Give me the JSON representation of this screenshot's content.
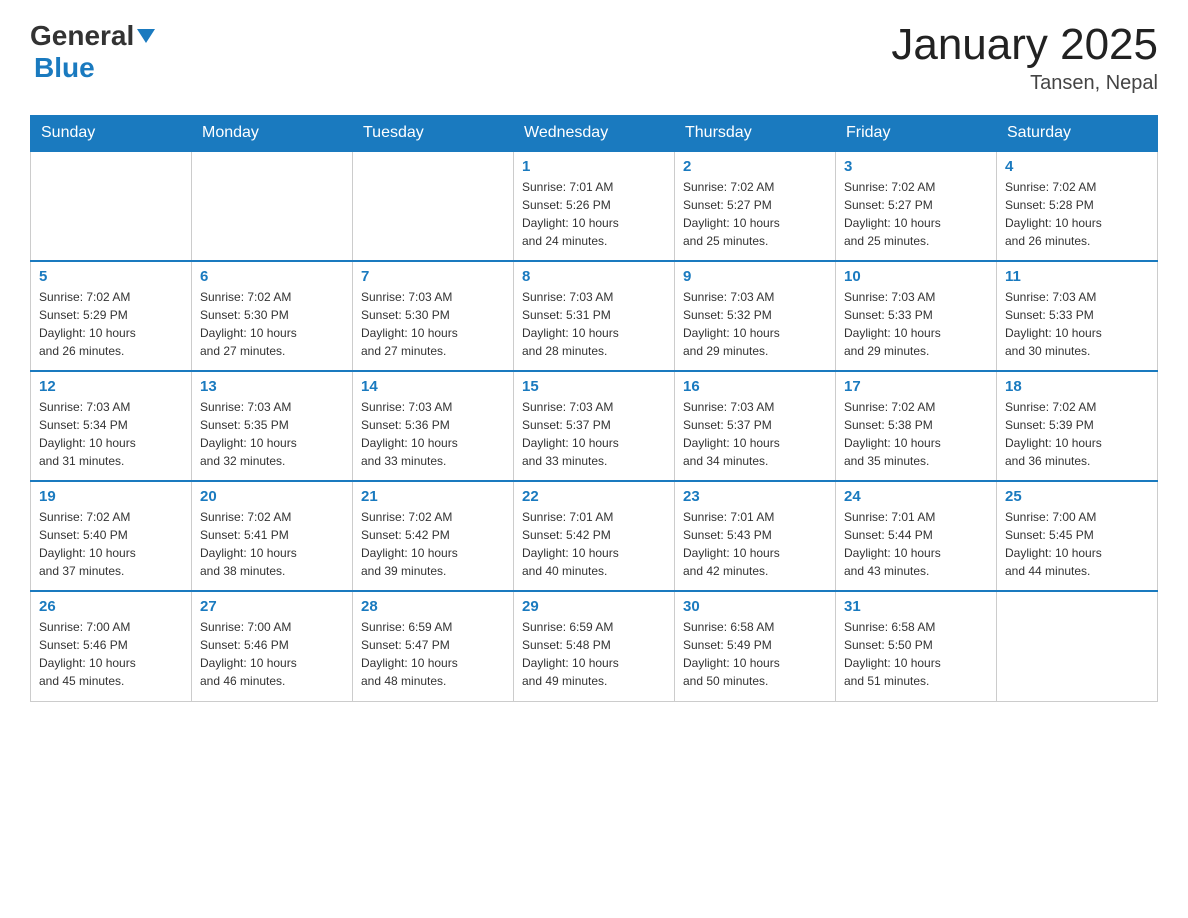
{
  "header": {
    "logo_general": "General",
    "logo_blue": "Blue",
    "month_title": "January 2025",
    "location": "Tansen, Nepal"
  },
  "calendar": {
    "days_of_week": [
      "Sunday",
      "Monday",
      "Tuesday",
      "Wednesday",
      "Thursday",
      "Friday",
      "Saturday"
    ],
    "weeks": [
      {
        "days": [
          {
            "number": "",
            "info": ""
          },
          {
            "number": "",
            "info": ""
          },
          {
            "number": "",
            "info": ""
          },
          {
            "number": "1",
            "info": "Sunrise: 7:01 AM\nSunset: 5:26 PM\nDaylight: 10 hours\nand 24 minutes."
          },
          {
            "number": "2",
            "info": "Sunrise: 7:02 AM\nSunset: 5:27 PM\nDaylight: 10 hours\nand 25 minutes."
          },
          {
            "number": "3",
            "info": "Sunrise: 7:02 AM\nSunset: 5:27 PM\nDaylight: 10 hours\nand 25 minutes."
          },
          {
            "number": "4",
            "info": "Sunrise: 7:02 AM\nSunset: 5:28 PM\nDaylight: 10 hours\nand 26 minutes."
          }
        ]
      },
      {
        "days": [
          {
            "number": "5",
            "info": "Sunrise: 7:02 AM\nSunset: 5:29 PM\nDaylight: 10 hours\nand 26 minutes."
          },
          {
            "number": "6",
            "info": "Sunrise: 7:02 AM\nSunset: 5:30 PM\nDaylight: 10 hours\nand 27 minutes."
          },
          {
            "number": "7",
            "info": "Sunrise: 7:03 AM\nSunset: 5:30 PM\nDaylight: 10 hours\nand 27 minutes."
          },
          {
            "number": "8",
            "info": "Sunrise: 7:03 AM\nSunset: 5:31 PM\nDaylight: 10 hours\nand 28 minutes."
          },
          {
            "number": "9",
            "info": "Sunrise: 7:03 AM\nSunset: 5:32 PM\nDaylight: 10 hours\nand 29 minutes."
          },
          {
            "number": "10",
            "info": "Sunrise: 7:03 AM\nSunset: 5:33 PM\nDaylight: 10 hours\nand 29 minutes."
          },
          {
            "number": "11",
            "info": "Sunrise: 7:03 AM\nSunset: 5:33 PM\nDaylight: 10 hours\nand 30 minutes."
          }
        ]
      },
      {
        "days": [
          {
            "number": "12",
            "info": "Sunrise: 7:03 AM\nSunset: 5:34 PM\nDaylight: 10 hours\nand 31 minutes."
          },
          {
            "number": "13",
            "info": "Sunrise: 7:03 AM\nSunset: 5:35 PM\nDaylight: 10 hours\nand 32 minutes."
          },
          {
            "number": "14",
            "info": "Sunrise: 7:03 AM\nSunset: 5:36 PM\nDaylight: 10 hours\nand 33 minutes."
          },
          {
            "number": "15",
            "info": "Sunrise: 7:03 AM\nSunset: 5:37 PM\nDaylight: 10 hours\nand 33 minutes."
          },
          {
            "number": "16",
            "info": "Sunrise: 7:03 AM\nSunset: 5:37 PM\nDaylight: 10 hours\nand 34 minutes."
          },
          {
            "number": "17",
            "info": "Sunrise: 7:02 AM\nSunset: 5:38 PM\nDaylight: 10 hours\nand 35 minutes."
          },
          {
            "number": "18",
            "info": "Sunrise: 7:02 AM\nSunset: 5:39 PM\nDaylight: 10 hours\nand 36 minutes."
          }
        ]
      },
      {
        "days": [
          {
            "number": "19",
            "info": "Sunrise: 7:02 AM\nSunset: 5:40 PM\nDaylight: 10 hours\nand 37 minutes."
          },
          {
            "number": "20",
            "info": "Sunrise: 7:02 AM\nSunset: 5:41 PM\nDaylight: 10 hours\nand 38 minutes."
          },
          {
            "number": "21",
            "info": "Sunrise: 7:02 AM\nSunset: 5:42 PM\nDaylight: 10 hours\nand 39 minutes."
          },
          {
            "number": "22",
            "info": "Sunrise: 7:01 AM\nSunset: 5:42 PM\nDaylight: 10 hours\nand 40 minutes."
          },
          {
            "number": "23",
            "info": "Sunrise: 7:01 AM\nSunset: 5:43 PM\nDaylight: 10 hours\nand 42 minutes."
          },
          {
            "number": "24",
            "info": "Sunrise: 7:01 AM\nSunset: 5:44 PM\nDaylight: 10 hours\nand 43 minutes."
          },
          {
            "number": "25",
            "info": "Sunrise: 7:00 AM\nSunset: 5:45 PM\nDaylight: 10 hours\nand 44 minutes."
          }
        ]
      },
      {
        "days": [
          {
            "number": "26",
            "info": "Sunrise: 7:00 AM\nSunset: 5:46 PM\nDaylight: 10 hours\nand 45 minutes."
          },
          {
            "number": "27",
            "info": "Sunrise: 7:00 AM\nSunset: 5:46 PM\nDaylight: 10 hours\nand 46 minutes."
          },
          {
            "number": "28",
            "info": "Sunrise: 6:59 AM\nSunset: 5:47 PM\nDaylight: 10 hours\nand 48 minutes."
          },
          {
            "number": "29",
            "info": "Sunrise: 6:59 AM\nSunset: 5:48 PM\nDaylight: 10 hours\nand 49 minutes."
          },
          {
            "number": "30",
            "info": "Sunrise: 6:58 AM\nSunset: 5:49 PM\nDaylight: 10 hours\nand 50 minutes."
          },
          {
            "number": "31",
            "info": "Sunrise: 6:58 AM\nSunset: 5:50 PM\nDaylight: 10 hours\nand 51 minutes."
          },
          {
            "number": "",
            "info": ""
          }
        ]
      }
    ]
  }
}
